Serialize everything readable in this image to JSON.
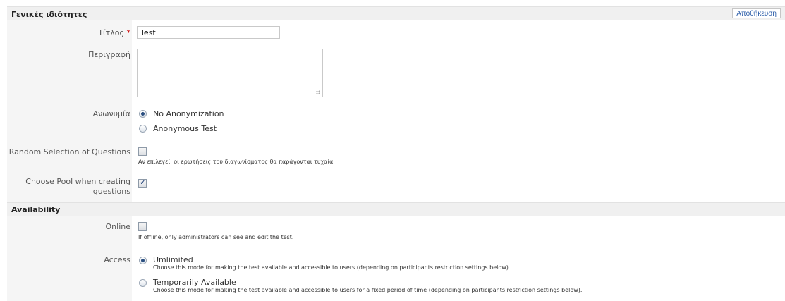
{
  "sections": {
    "general": {
      "title": "Γενικές ιδιότητες",
      "save_label": "Αποθήκευση"
    },
    "availability": {
      "title": "Availability"
    }
  },
  "fields": {
    "title": {
      "label": "Τίτλος",
      "required_mark": "*",
      "value": "Test"
    },
    "description": {
      "label": "Περιγραφή",
      "value": ""
    },
    "anonymity": {
      "label": "Ανωνυμία",
      "options": [
        {
          "label": "No Anonymization",
          "checked": true
        },
        {
          "label": "Anonymous Test",
          "checked": false
        }
      ]
    },
    "random_selection": {
      "label": "Random Selection of Questions",
      "checked": false,
      "hint": "Αν επιλεγεί, οι ερωτήσεις του διαγωνίσματος θα παράγονται τυχαία"
    },
    "choose_pool": {
      "label_line1": "Choose Pool when creating",
      "label_line2": "questions",
      "checked": true
    },
    "online": {
      "label": "Online",
      "checked": false,
      "hint": "If offline, only administrators can see and edit the test."
    },
    "access": {
      "label": "Access",
      "options": [
        {
          "label": "Umlimited",
          "hint": "Choose this mode for making the test available and accessible to users (depending on participants restriction settings below).",
          "checked": true
        },
        {
          "label": "Temporarily Available",
          "hint": "Choose this mode for making the test available and accessible to users for a fixed period of time (depending on participants restriction settings below).",
          "checked": false
        }
      ]
    }
  }
}
